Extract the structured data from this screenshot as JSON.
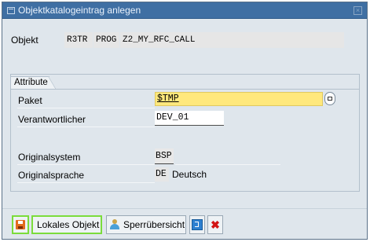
{
  "window": {
    "title": "Objektkatalogeintrag anlegen"
  },
  "object": {
    "label": "Objekt",
    "pgmid": "R3TR",
    "type": "PROG",
    "name": "Z2_MY_RFC_CALL"
  },
  "attributes": {
    "group_title": "Attribute",
    "paket_label": "Paket",
    "paket_value": "$TMP",
    "verantwortlicher_label": "Verantwortlicher",
    "verantwortlicher_value": "DEV_01",
    "originalsystem_label": "Originalsystem",
    "originalsystem_value": "BSP",
    "originalsprache_label": "Originalsprache",
    "originalsprache_code": "DE",
    "originalsprache_name": "Deutsch"
  },
  "toolbar": {
    "lokales_objekt_label": "Lokales Objekt",
    "sperruebersicht_label": "Sperrübersicht"
  },
  "colors": {
    "titlebar": "#3f6fa3",
    "window_bg": "#dfe6ec",
    "required_field": "#ffe87c",
    "focus_highlight": "#7bdc3c",
    "cancel_icon": "#d21414"
  },
  "icons": {
    "title": "window-icon",
    "close": "close-icon",
    "paket_help": "value-help-icon",
    "save": "save-icon",
    "sperruebersicht": "person-icon",
    "info": "info-icon",
    "cancel": "cancel-icon"
  }
}
